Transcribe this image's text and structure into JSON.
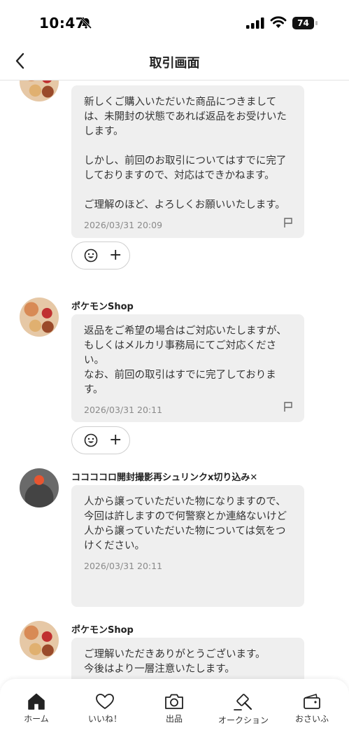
{
  "status_bar": {
    "time": "10:47",
    "battery": "74"
  },
  "header": {
    "title": "取引画面"
  },
  "messages": [
    {
      "text": "新しくご購入いただいた商品につきましては、未開封の状態であれば返品をお受けいたします。\n\nしかし、前回のお取引についてはすでに完了しておりますので、対応はできかねます。\n\nご理解のほど、よろしくお願いいたします。",
      "timestamp": "2026/03/31 20:09"
    },
    {
      "sender": "ポケモンShop",
      "text": "返品をご希望の場合はご対応いたしますが、もしくはメルカリ事務局にてご対応ください。\nなお、前回の取引はすでに完了しております。",
      "timestamp": "2026/03/31 20:11"
    },
    {
      "sender": "ココココロ開封撮影再シュリンクx切り込み✕",
      "text": "人から譲っていただいた物になりますので、\n今回は許しますので何警察とか連絡ないけど\n人から譲っていただいた物については気をつけください。",
      "timestamp": "2026/03/31 20:11"
    },
    {
      "sender": "ポケモンShop",
      "text": "ご理解いただきありがとうございます。\n今後はより一層注意いたします。"
    }
  ],
  "tabbar": {
    "home": "ホーム",
    "likes": "いいね！",
    "sell": "出品",
    "auction": "オークション",
    "wallet": "おさいふ"
  }
}
